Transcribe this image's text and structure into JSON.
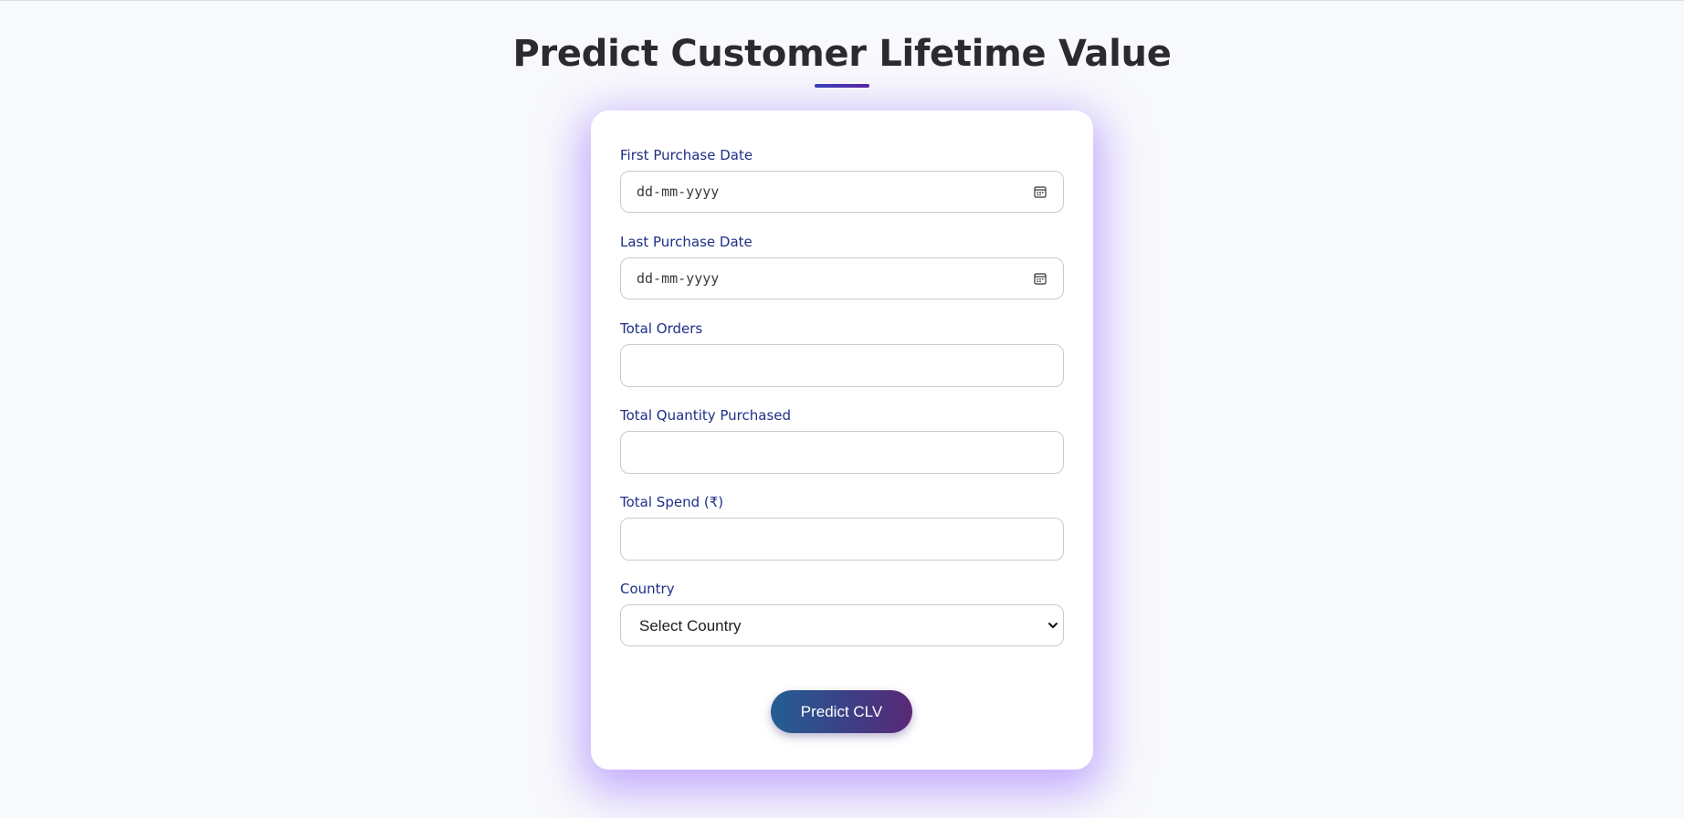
{
  "header": {
    "title": "Predict Customer Lifetime Value"
  },
  "form": {
    "first_purchase_date": {
      "label": "First Purchase Date",
      "placeholder": "dd-mm-yyyy",
      "icon": "calendar-icon"
    },
    "last_purchase_date": {
      "label": "Last Purchase Date",
      "placeholder": "dd-mm-yyyy",
      "icon": "calendar-icon"
    },
    "total_orders": {
      "label": "Total Orders",
      "value": ""
    },
    "total_quantity": {
      "label": "Total Quantity Purchased",
      "value": ""
    },
    "total_spend": {
      "label": "Total Spend (₹)",
      "value": ""
    },
    "country": {
      "label": "Country",
      "selected": "Select Country",
      "icon": "chevron-down-icon"
    },
    "submit_label": "Predict CLV"
  },
  "colors": {
    "page_background": "#f8f9fc",
    "label_text": "#1d2f86",
    "card_glow": "#9669ff",
    "button_gradient_start": "#235f93",
    "button_gradient_end": "#5a2876"
  }
}
